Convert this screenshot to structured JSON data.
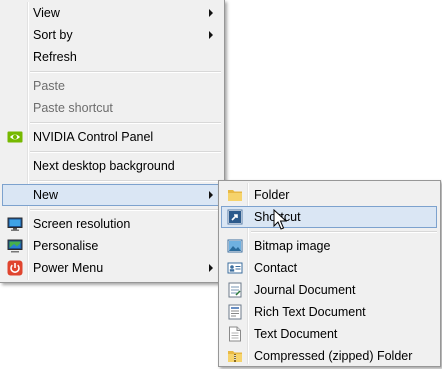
{
  "context_menu": {
    "items": [
      {
        "label": "View"
      },
      {
        "label": "Sort by"
      },
      {
        "label": "Refresh"
      },
      {
        "label": "Paste"
      },
      {
        "label": "Paste shortcut"
      },
      {
        "label": "NVIDIA Control Panel",
        "icon": "nvidia-icon"
      },
      {
        "label": "Next desktop background"
      },
      {
        "label": "New"
      },
      {
        "label": "Screen resolution",
        "icon": "display-icon"
      },
      {
        "label": "Personalise",
        "icon": "personalise-icon"
      },
      {
        "label": "Power Menu",
        "icon": "power-icon"
      }
    ]
  },
  "new_submenu": {
    "items": [
      {
        "label": "Folder",
        "icon": "folder-icon"
      },
      {
        "label": "Shortcut",
        "icon": "shortcut-icon"
      },
      {
        "label": "Bitmap image",
        "icon": "bitmap-icon"
      },
      {
        "label": "Contact",
        "icon": "contact-icon"
      },
      {
        "label": "Journal Document",
        "icon": "journal-icon"
      },
      {
        "label": "Rich Text Document",
        "icon": "rich-text-icon"
      },
      {
        "label": "Text Document",
        "icon": "text-document-icon"
      },
      {
        "label": "Compressed (zipped) Folder",
        "icon": "zip-folder-icon"
      }
    ]
  },
  "colors": {
    "menu_background": "#f0f0f0",
    "highlight": "#dae6f4",
    "highlight_border": "#7da2ce",
    "disabled_text": "#6d6d6d"
  }
}
